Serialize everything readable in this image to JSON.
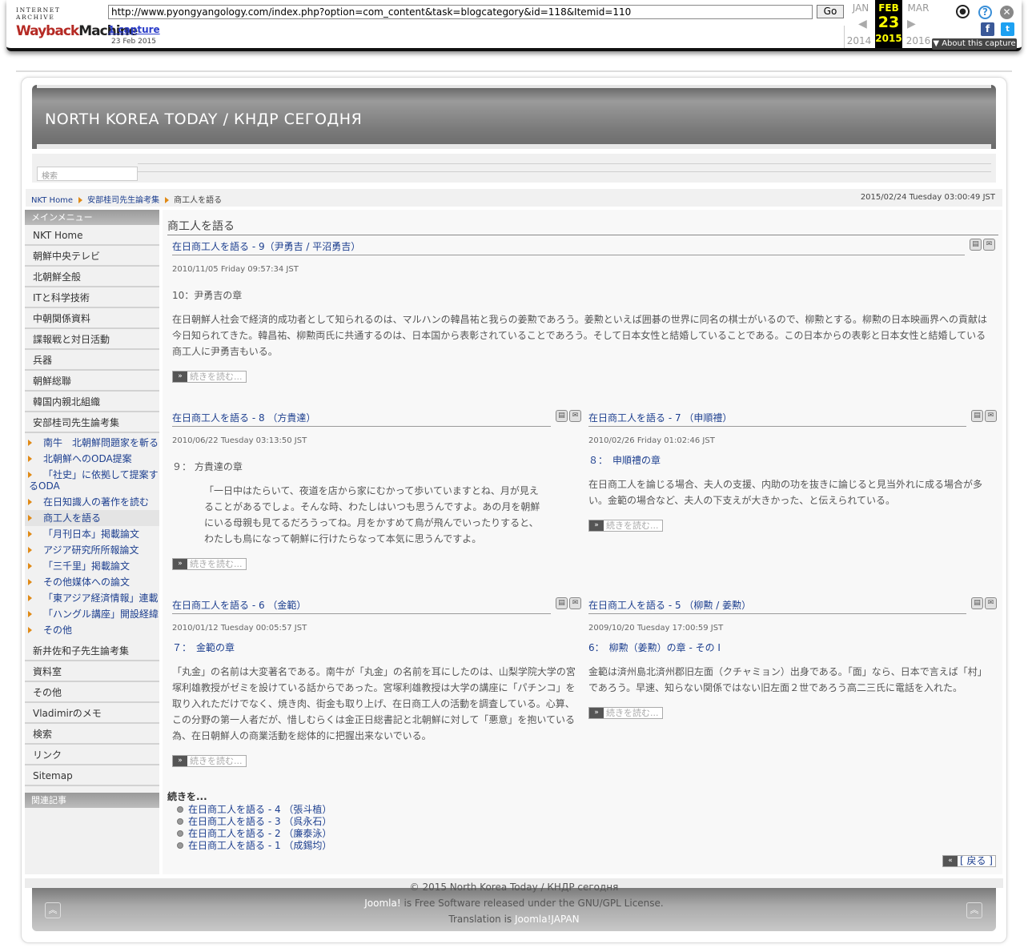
{
  "wayback": {
    "logo_top": "INTERNET ARCHIVE",
    "logo_a": "Wayback",
    "logo_b": "Machine",
    "url": "http://www.pyongyangology.com/index.php?option=com_content&task=blogcategory&id=118&Itemid=110",
    "go_label": "Go",
    "captures_label": "1 capture",
    "capture_date": "23 Feb 2015",
    "prev_month": "JAN",
    "cur_month": "FEB",
    "next_month": "MAR",
    "cur_day": "23",
    "prev_year": "2014",
    "cur_year": "2015",
    "next_year": "2016",
    "about_label": "About this capture"
  },
  "site": {
    "title": "NORTH KOREA TODAY / КНДР СЕГОДНЯ",
    "search_placeholder": "検索"
  },
  "breadcrumb": {
    "home": "NKT Home",
    "section": "安部桂司先生論考集",
    "current": "商工人を語る",
    "datetime": "2015/02/24 Tuesday 03:00:49 JST"
  },
  "sidebar": {
    "main_menu_heading": "メインメニュー",
    "items_top": [
      "NKT Home",
      "朝鮮中央テレビ",
      "北朝鮮全般",
      "ITと科学技術",
      "中朝関係資料",
      "諜報戦と対日活動",
      "兵器",
      "朝鮮総聯",
      "韓国内親北組織",
      "安部桂司先生論考集"
    ],
    "subitems": [
      "南牛　北朝鮮問題家を斬る",
      "北朝鮮へのODA提案",
      "「社史」に依拠して提案するODA",
      "在日知識人の著作を読む",
      "商工人を語る",
      "「月刊日本」掲載論文",
      "アジア研究所所報論文",
      "「三千里」掲載論文",
      "その他媒体への論文",
      "「東アジア経済情報」連載",
      "「ハングル講座」開設経緯",
      "その他"
    ],
    "items_bottom": [
      "新井佐和子先生論考集",
      "資料室",
      "その他",
      "Vladimirのメモ",
      "検索",
      "リンク",
      "Sitemap"
    ],
    "related_heading": "関連記事"
  },
  "content": {
    "category_title": "商工人を語る",
    "read_more": "続きを読む...",
    "articles": [
      {
        "title": "在日商工人を語る - 9（尹勇吉 / 平沼勇吉）",
        "date": "2010/11/05 Friday 09:57:34 JST",
        "heading": "10：尹勇吉の章",
        "body": "在日朝鮮人社会で経済的成功者として知られるのは、マルハンの韓昌祐と我らの姜勲であろう。姜勲といえば囲碁の世界に同名の棋士がいるので、柳勲とする。柳勲の日本映画界への貢献は今日知られてきた。韓昌祐、柳勲両氏に共通するのは、日本国から表彰されていることであろう。そして日本女性と結婚していることである。この日本からの表彰と日本女性と結婚している商工人に尹勇吉もいる。"
      },
      {
        "title": "在日商工人を語る - 8 （方貴達）",
        "date": "2010/06/22 Tuesday 03:13:50 JST",
        "heading": "９： 方貴達の章",
        "body": "「一日中はたらいて、夜道を店から家にむかって歩いていますとね、月が見えることがあるでしょ。そんな時、わたしはいつも思うんですよ。あの月を朝鮮にいる母親も見てるだろうってね。月をかすめて鳥が飛んでいったりすると、わたしも鳥になって朝鮮に行けたらなって本気に思うんですよ。"
      },
      {
        "title": "在日商工人を語る - 7 （申順禮）",
        "date": "2010/02/26 Friday 01:02:46 JST",
        "heading": "８：　申順禮の章",
        "body": "在日商工人を論じる場合、夫人の支援、内助の功を抜きに論じると見当外れに成る場合が多い。金範の場合など、夫人の下支えが大きかった、と伝えられている。"
      },
      {
        "title": "在日商工人を語る - 6 （金範）",
        "date": "2010/01/12 Tuesday 00:05:57 JST",
        "heading": "７：　金範の章",
        "body": "「丸金」の名前は大変著名である。南牛が「丸金」の名前を耳にしたのは、山梨学院大学の宮塚利雄教授がゼミを設けている話からであった。宮塚利雄教授は大学の講座に「パチンコ」を取り入れただけでなく、焼き肉、街金も取り上げ、在日商工人の活動を調査している。心算、この分野の第一人者だが、惜しむらくは金正日総書記と北朝鮮に対して「悪意」を抱いている為、在日朝鮮人の商業活動を総体的に把握出来ないでいる。"
      },
      {
        "title": "在日商工人を語る - 5 （柳勲 / 姜勲）",
        "date": "2009/10/20 Tuesday 17:00:59 JST",
        "heading": "6：　柳勲（姜勲）の章 - その I",
        "body": "金範は済州島北済州郡旧左面（クチャミョン）出身である。「面」なら、日本で言えば「村」であろう。早速、知らない関係ではない旧左面２世であろう高二三氏に電話を入れた。"
      }
    ],
    "more_heading": "続きを...",
    "more_links": [
      "在日商工人を語る - 4 （張斗植）",
      "在日商工人を語る - 3 （呉永石）",
      "在日商工人を語る - 2 （廉泰泳）",
      "在日商工人を語る - 1 （成錫均）"
    ],
    "back_label": "[ 戻る ]"
  },
  "footer": {
    "copyright": "© 2015 North Korea Today / КНДР сегодня",
    "joomla": "Joomla!",
    "license": " is Free Software released under the GNU/GPL License.",
    "translation_prefix": "Translation is ",
    "translation_link": "Joomla!JAPAN"
  }
}
